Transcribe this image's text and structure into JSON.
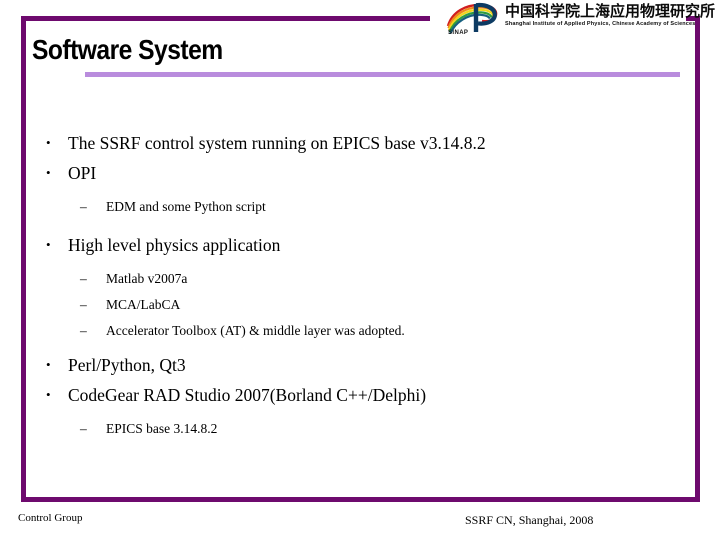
{
  "slide": {
    "title": "Software System",
    "accent_color": "#6E0A6E",
    "rule_color": "#B98CDD",
    "background": "#ffffff"
  },
  "logo": {
    "mark_name": "sinap-logo",
    "acronym": "SINAP",
    "chinese_name": "中国科学院上海应用物理研究所",
    "english_name": "Shanghai Institute of Applied Physics, Chinese Academy of Sciences"
  },
  "content": {
    "blocks": [
      {
        "level": 1,
        "text": "The SSRF control system running on EPICS base v3.14.8.2"
      },
      {
        "level": 1,
        "text": "OPI"
      },
      {
        "level": 2,
        "text": "EDM and some Python script"
      },
      {
        "level": 1,
        "text": "High level physics application"
      },
      {
        "level": 2,
        "text": "Matlab v2007a"
      },
      {
        "level": 2,
        "text": "MCA/LabCA"
      },
      {
        "level": 2,
        "text": "Accelerator Toolbox (AT) & middle layer was adopted."
      },
      {
        "level": 1,
        "text": "Perl/Python, Qt3"
      },
      {
        "level": 1,
        "text": "CodeGear RAD Studio 2007(Borland C++/Delphi)"
      },
      {
        "level": 2,
        "text": "EPICS base 3.14.8.2"
      }
    ]
  },
  "footer": {
    "left": "Control Group",
    "right": "SSRF CN, Shanghai, 2008"
  }
}
